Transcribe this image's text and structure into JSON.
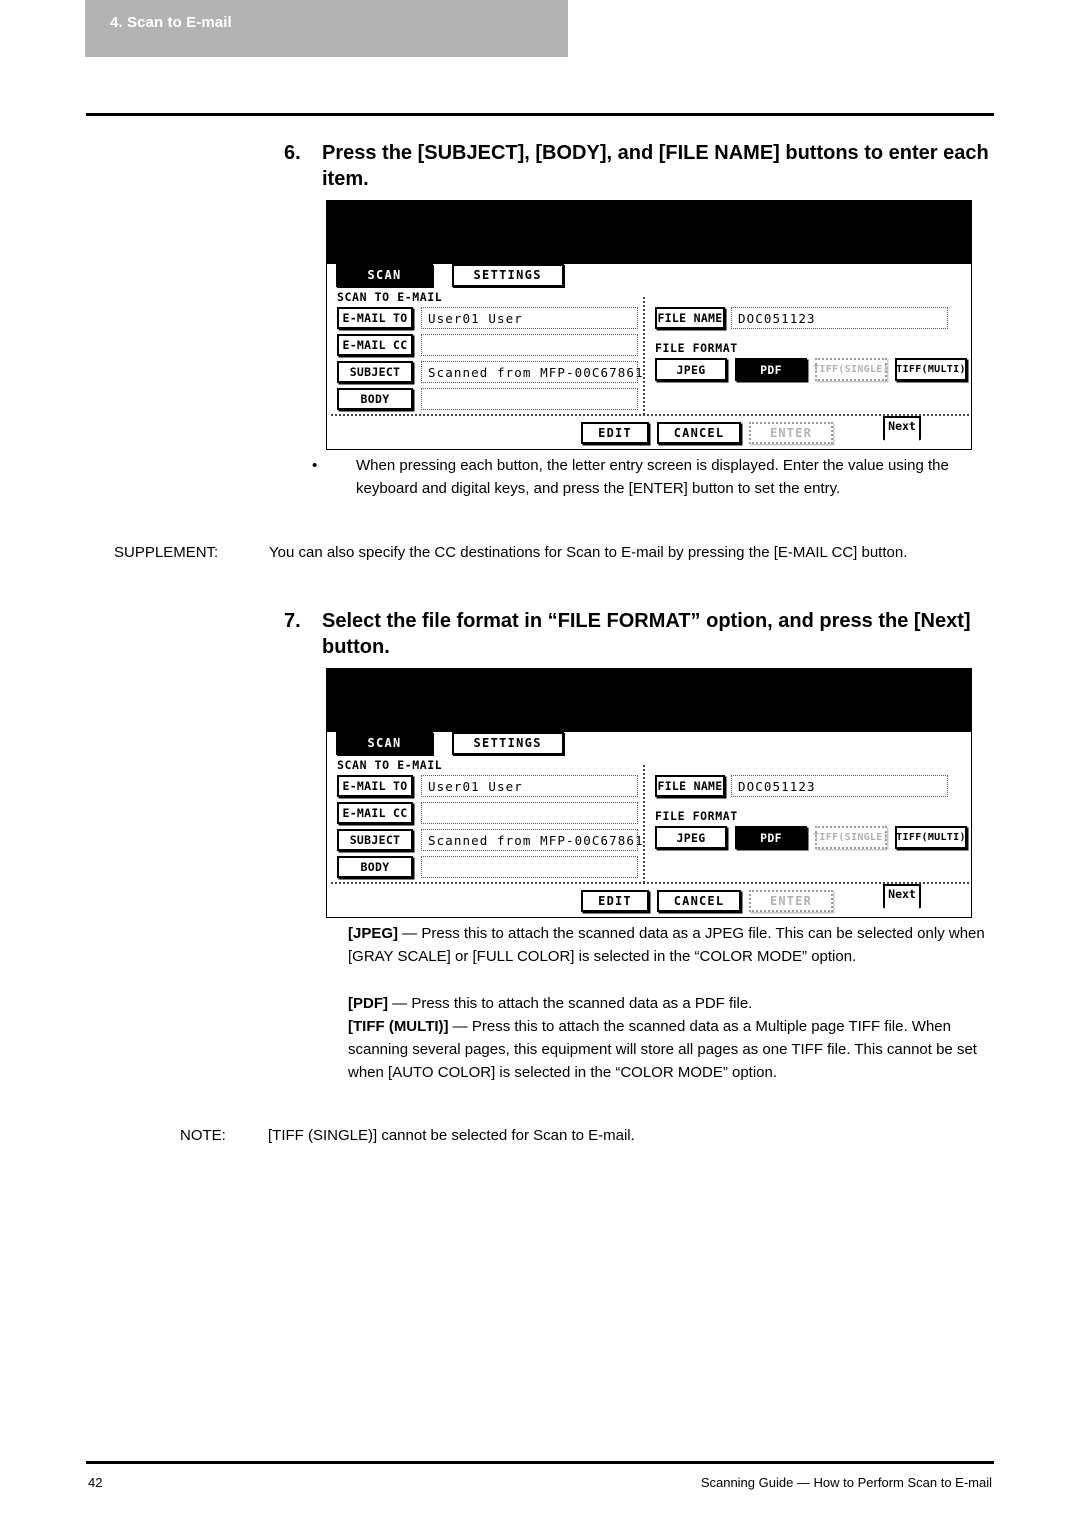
{
  "running_head": {
    "text": "4. Scan to E-mail"
  },
  "footer": {
    "page_number": "42",
    "guide_text": "Scanning Guide — How to Perform Scan to E-mail"
  },
  "steps": [
    {
      "number": "6.",
      "text": "Press the [SUBJECT], [BODY], and [FILE NAME] buttons to enter each item."
    },
    {
      "number": "7.",
      "text": "Select the file format in “FILE FORMAT” option, and press the [Next] button."
    }
  ],
  "bullet_after_step6": {
    "marker": "•",
    "text": "When pressing each button, the letter entry screen is displayed.  Enter the value using the keyboard and digital keys, and press the [ENTER] button to set the entry."
  },
  "supplement": {
    "label": "SUPPLEMENT:",
    "text": "You can also specify the CC destinations for Scan to E-mail by pressing the [E-MAIL CC] button."
  },
  "format_descriptions": {
    "jpeg_key": "[JPEG]",
    "jpeg_text": " — Press this to attach the scanned data as a JPEG file.  This can be selected only when [GRAY SCALE] or [FULL COLOR] is selected in the “COLOR MODE” option.",
    "pdf_key": "[PDF]",
    "pdf_text": " — Press this to attach the scanned data as a PDF file.",
    "tiff_key": "[TIFF (MULTI)]",
    "tiff_text": " — Press this to attach the scanned data as a Multiple page TIFF file.  When scanning several pages, this equipment will store all pages as one TIFF file.  This cannot be set when [AUTO COLOR] is selected in the “COLOR MODE” option."
  },
  "note": {
    "label": "NOTE:",
    "text": "[TIFF (SINGLE)] cannot be selected for Scan to E-mail."
  },
  "lcd": {
    "tabs": [
      {
        "label": "SCAN",
        "selected": true
      },
      {
        "label": "SETTINGS",
        "selected": false
      }
    ],
    "screen_title": "SCAN TO E-MAIL",
    "left_rows": [
      {
        "key": "E-MAIL TO",
        "value": "User01 User"
      },
      {
        "key": "E-MAIL CC",
        "value": ""
      },
      {
        "key": "SUBJECT",
        "value": "Scanned from MFP-00C67861"
      },
      {
        "key": "BODY",
        "value": ""
      }
    ],
    "file_name_key": "FILE NAME",
    "file_name_value": "DOC051123",
    "file_format_label": "FILE FORMAT",
    "file_format_buttons": [
      {
        "label": "JPEG",
        "state": "normal"
      },
      {
        "label": "PDF",
        "state": "selected"
      },
      {
        "label": "TIFF(SINGLE)",
        "state": "disabled"
      },
      {
        "label": "TIFF(MULTI)",
        "state": "normal"
      }
    ],
    "action_buttons": [
      {
        "label": "EDIT",
        "state": "normal"
      },
      {
        "label": "CANCEL",
        "state": "normal"
      },
      {
        "label": "ENTER",
        "state": "disabled"
      }
    ],
    "next_button": {
      "label": "Next"
    }
  },
  "colors": {
    "runhead_bg": "#b3b3b3",
    "runhead_fg": "#ffffff",
    "lcd_bg": "#ffffff",
    "lcd_header_bg": "#000000",
    "disabled_fg": "#b2b2b2"
  }
}
